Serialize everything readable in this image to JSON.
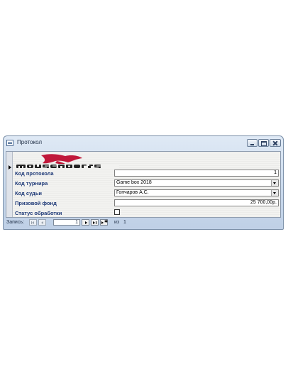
{
  "window": {
    "title": "Протокол"
  },
  "form": {
    "fields": [
      {
        "label": "Код протокола",
        "value": "1",
        "control": "text"
      },
      {
        "label": "Код турнира",
        "value": "Game box 2018",
        "control": "combo"
      },
      {
        "label": "Код судьи",
        "value": "Гончаров А.С.",
        "control": "combo"
      },
      {
        "label": "Призовой фонд",
        "value": "25 700,00р.",
        "control": "text"
      },
      {
        "label": "Статус обработки",
        "checked": false,
        "control": "checkbox"
      }
    ],
    "logo": {
      "colors": {
        "primary": "#c0183a",
        "text": "#222222"
      }
    }
  },
  "navigation": {
    "label": "Запись:",
    "current": "1",
    "of_label": "из",
    "total": "1"
  },
  "colors": {
    "label_text": "#1f3a78",
    "window_frame": "#c9d9ec",
    "form_bg": "#f2f2f0"
  }
}
